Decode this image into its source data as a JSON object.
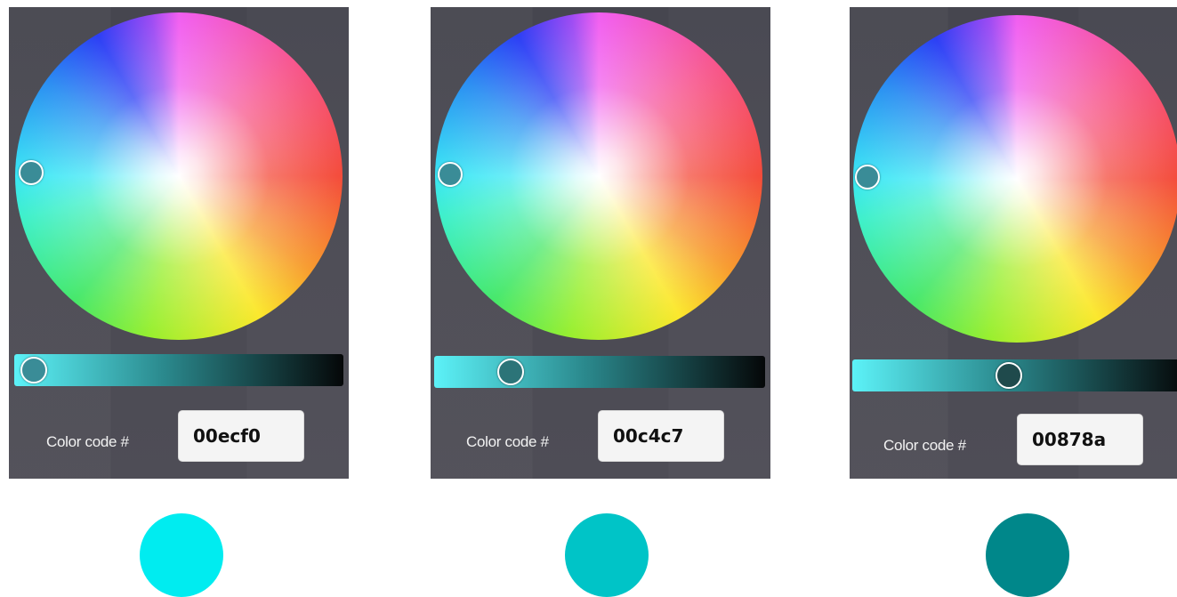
{
  "pickers": [
    {
      "label": "Color code #",
      "code": "00ecf0",
      "handle_color": "#3a8c97",
      "slider_handle_color": "#3a8c97",
      "slider_level": 0.06,
      "swatch_color": "#00ecf0"
    },
    {
      "label": "Color code #",
      "code": "00c4c7",
      "handle_color": "#3a8c97",
      "slider_handle_color": "#2c7478",
      "slider_level": 0.23,
      "swatch_color": "#00c4c7"
    },
    {
      "label": "Color code #",
      "code": "00878a",
      "handle_color": "#3a8c97",
      "slider_handle_color": "#1f4a4c",
      "slider_level": 0.47,
      "swatch_color": "#00878a"
    }
  ],
  "colors": {
    "slider_start": "#5cf2f8",
    "slider_mid": "#2b8a8e",
    "slider_end": "#050708",
    "panel_bg": "#4a4953"
  }
}
